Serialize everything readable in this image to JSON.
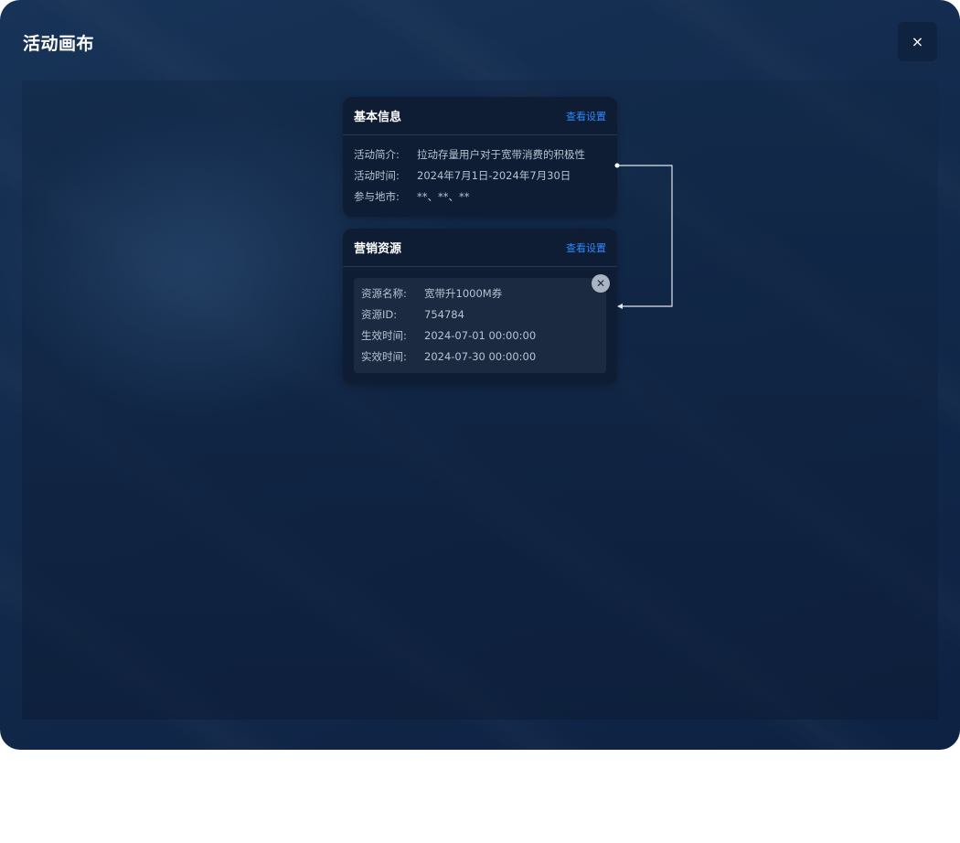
{
  "window": {
    "title": "活动画布",
    "close_icon": "×"
  },
  "basic_info": {
    "title": "基本信息",
    "link": "查看设置",
    "rows": [
      {
        "label": "活动简介:",
        "value": "拉动存量用户对于宽带消费的积极性"
      },
      {
        "label": "活动时间:",
        "value": "2024年7月1日-2024年7月30日"
      },
      {
        "label": "参与地市:",
        "value": "**、**、**"
      }
    ]
  },
  "marketing": {
    "title": "营销资源",
    "link": "查看设置",
    "delete_icon": "✕",
    "resource": [
      {
        "label": "资源名称:",
        "value": "宽带升1000M券"
      },
      {
        "label": "资源ID:",
        "value": "754784"
      },
      {
        "label": "生效时间:",
        "value": "2024-07-01 00:00:00"
      },
      {
        "label": "实效时间:",
        "value": "2024-07-30 00:00:00"
      }
    ]
  },
  "colors": {
    "accent_link": "#2f88ff",
    "card_bg": "#0e1d33",
    "connector": "#dfe6f0"
  }
}
